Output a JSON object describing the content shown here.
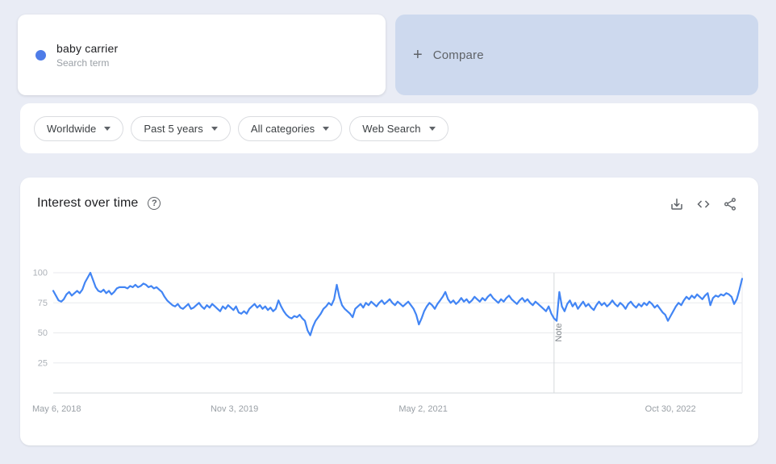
{
  "search_card": {
    "term": "baby carrier",
    "type_label": "Search term",
    "dot_color": "#4e7ce8"
  },
  "compare_card": {
    "plus": "+",
    "label": "Compare"
  },
  "filters": [
    {
      "label": "Worldwide"
    },
    {
      "label": "Past 5 years"
    },
    {
      "label": "All categories"
    },
    {
      "label": "Web Search"
    }
  ],
  "chart_card": {
    "title": "Interest over time",
    "help_glyph": "?",
    "toolbar_icons": [
      "download-icon",
      "embed-icon",
      "share-icon"
    ]
  },
  "chart_data": {
    "type": "line",
    "title": "Interest over time",
    "xlabel": "",
    "ylabel": "",
    "ylim": [
      0,
      100
    ],
    "grid": true,
    "y_ticks": [
      100,
      75,
      50,
      25
    ],
    "x_ticks": [
      {
        "label": "May 6, 2018",
        "frac": 0.0,
        "align": "left"
      },
      {
        "label": "Nov 3, 2019",
        "frac": 0.263,
        "align": "center"
      },
      {
        "label": "May 2, 2021",
        "frac": 0.537,
        "align": "center"
      },
      {
        "label": "Oct 30, 2022",
        "frac": 0.896,
        "align": "center"
      }
    ],
    "note": {
      "label": "Note",
      "frac": 0.727
    },
    "series": [
      {
        "name": "baby carrier",
        "color": "#4285f4",
        "values": [
          85,
          81,
          77,
          76,
          78,
          82,
          84,
          81,
          83,
          85,
          83,
          86,
          92,
          96,
          100,
          94,
          88,
          85,
          84,
          86,
          83,
          85,
          82,
          84,
          87,
          88,
          88,
          88,
          87,
          89,
          88,
          90,
          88,
          89,
          91,
          90,
          88,
          89,
          87,
          88,
          86,
          84,
          80,
          77,
          75,
          73,
          72,
          74,
          71,
          70,
          72,
          74,
          70,
          71,
          73,
          75,
          72,
          70,
          73,
          71,
          74,
          72,
          70,
          68,
          72,
          70,
          73,
          71,
          69,
          72,
          67,
          66,
          68,
          66,
          70,
          72,
          74,
          71,
          73,
          70,
          72,
          69,
          71,
          68,
          70,
          77,
          72,
          68,
          65,
          63,
          62,
          64,
          63,
          65,
          62,
          60,
          52,
          48,
          55,
          60,
          63,
          66,
          70,
          72,
          75,
          73,
          78,
          90,
          80,
          73,
          70,
          68,
          66,
          63,
          70,
          72,
          74,
          71,
          75,
          73,
          76,
          74,
          72,
          75,
          77,
          74,
          76,
          78,
          75,
          73,
          76,
          74,
          72,
          74,
          76,
          73,
          70,
          65,
          57,
          62,
          68,
          72,
          75,
          73,
          70,
          74,
          77,
          80,
          84,
          78,
          75,
          77,
          74,
          76,
          79,
          76,
          78,
          75,
          77,
          80,
          78,
          76,
          79,
          77,
          80,
          82,
          79,
          77,
          75,
          78,
          76,
          79,
          81,
          78,
          76,
          74,
          77,
          79,
          76,
          78,
          75,
          73,
          76,
          74,
          72,
          70,
          68,
          72,
          66,
          62,
          60,
          84,
          72,
          68,
          74,
          77,
          72,
          75,
          70,
          73,
          76,
          72,
          74,
          71,
          69,
          73,
          76,
          73,
          75,
          72,
          74,
          77,
          74,
          72,
          75,
          73,
          70,
          74,
          76,
          73,
          71,
          74,
          72,
          75,
          73,
          76,
          74,
          71,
          73,
          70,
          67,
          65,
          60,
          64,
          68,
          72,
          75,
          73,
          77,
          80,
          78,
          81,
          79,
          82,
          80,
          78,
          81,
          83,
          73,
          79,
          81,
          80,
          82,
          81,
          83,
          82,
          80,
          74,
          78,
          86,
          95
        ]
      }
    ],
    "colors": {
      "gridline": "#e8eaed",
      "axis_line": "#d6d9dd",
      "note_line": "#d6d9dd",
      "y_tick_text": "#adb2b8",
      "x_tick_text": "#9aa0a6",
      "note_text": "#80868b"
    }
  }
}
